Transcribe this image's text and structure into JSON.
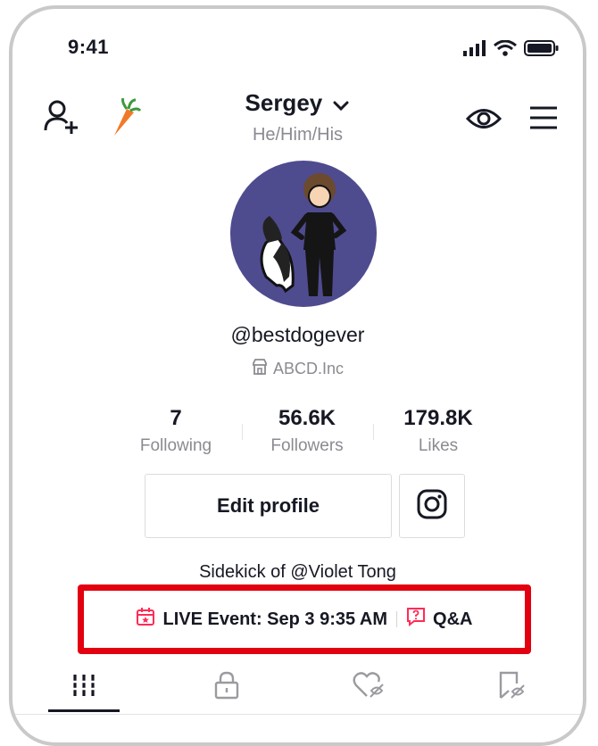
{
  "status_bar": {
    "time": "9:41",
    "icons": [
      "signal-icon",
      "wifi-icon",
      "battery-icon"
    ]
  },
  "header": {
    "name": "Sergey",
    "pronouns": "He/Him/His",
    "left_icons": [
      "add-friend-icon",
      "carrot-icon"
    ],
    "right_icons": [
      "eye-icon",
      "menu-icon"
    ]
  },
  "profile": {
    "username": "@bestdogever",
    "business": "ABCD.Inc",
    "bio": "Sidekick of @Violet Tong"
  },
  "stats": [
    {
      "value": "7",
      "label": "Following"
    },
    {
      "value": "56.6K",
      "label": "Followers"
    },
    {
      "value": "179.8K",
      "label": "Likes"
    }
  ],
  "buttons": {
    "edit_profile": "Edit profile"
  },
  "event": {
    "live_label": "LIVE Event: Sep 3 9:35 AM",
    "qa_label": "Q&A"
  },
  "tabs": [
    "videos-grid-icon",
    "private-lock-icon",
    "liked-hidden-icon",
    "favorites-hidden-icon"
  ],
  "colors": {
    "accent": "#fe2c55",
    "highlight_border": "#e3000f",
    "avatar_bg": "#4f4b8f",
    "muted_text": "#8a8b91"
  }
}
